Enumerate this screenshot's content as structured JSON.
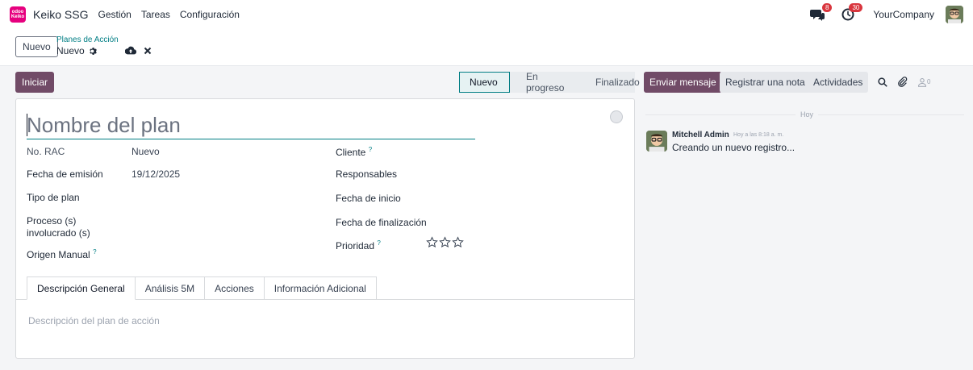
{
  "navbar": {
    "logo_text_top": "odoo",
    "logo_text_bottom": "Keiko",
    "brand": "Keiko SSG",
    "menus": [
      "Gestión",
      "Tareas",
      "Configuración"
    ],
    "messages_badge": "8",
    "activities_badge": "30",
    "company": "YourCompany"
  },
  "control": {
    "new_button": "Nuevo",
    "breadcrumb_parent": "Planes de Acción",
    "breadcrumb_current": "Nuevo"
  },
  "form": {
    "primary_button": "Iniciar",
    "stages": [
      "Nuevo",
      "En progreso",
      "Finalizado"
    ],
    "active_stage": "Nuevo",
    "title_placeholder": "Nombre del plan",
    "fields_left": [
      {
        "label": "No. RAC",
        "value": "Nuevo"
      },
      {
        "label": "Fecha de emisión",
        "value": "19/12/2025"
      },
      {
        "label": "Tipo de plan",
        "value": ""
      },
      {
        "label": "Proceso (s) involucrado (s)",
        "value": ""
      },
      {
        "label": "Origen Manual",
        "value": ""
      }
    ],
    "fields_right": [
      {
        "label": "Cliente",
        "value": ""
      },
      {
        "label": "Responsables",
        "value": ""
      },
      {
        "label": "Fecha de inicio",
        "value": ""
      },
      {
        "label": "Fecha de finalización",
        "value": ""
      },
      {
        "label": "Prioridad",
        "value": ""
      }
    ],
    "help_marker": "?",
    "priority_stars": 0,
    "priority_max": 3,
    "tabs": [
      "Descripción General",
      "Análisis 5M",
      "Acciones",
      "Información Adicional"
    ],
    "active_tab": "Descripción General",
    "tab_placeholder": "Descripción del plan de acción"
  },
  "chatter": {
    "send_message": "Enviar mensaje",
    "log_note": "Registrar una nota",
    "activities": "Actividades",
    "follower_count": "0",
    "date_separator": "Hoy",
    "messages": [
      {
        "author": "Mitchell Admin",
        "time": "Hoy a las 8:18 a. m.",
        "body": "Creando un nuevo registro..."
      }
    ]
  },
  "colors": {
    "brand_purple": "#714b67",
    "teal": "#017e84",
    "badge_red": "#d9363e"
  }
}
